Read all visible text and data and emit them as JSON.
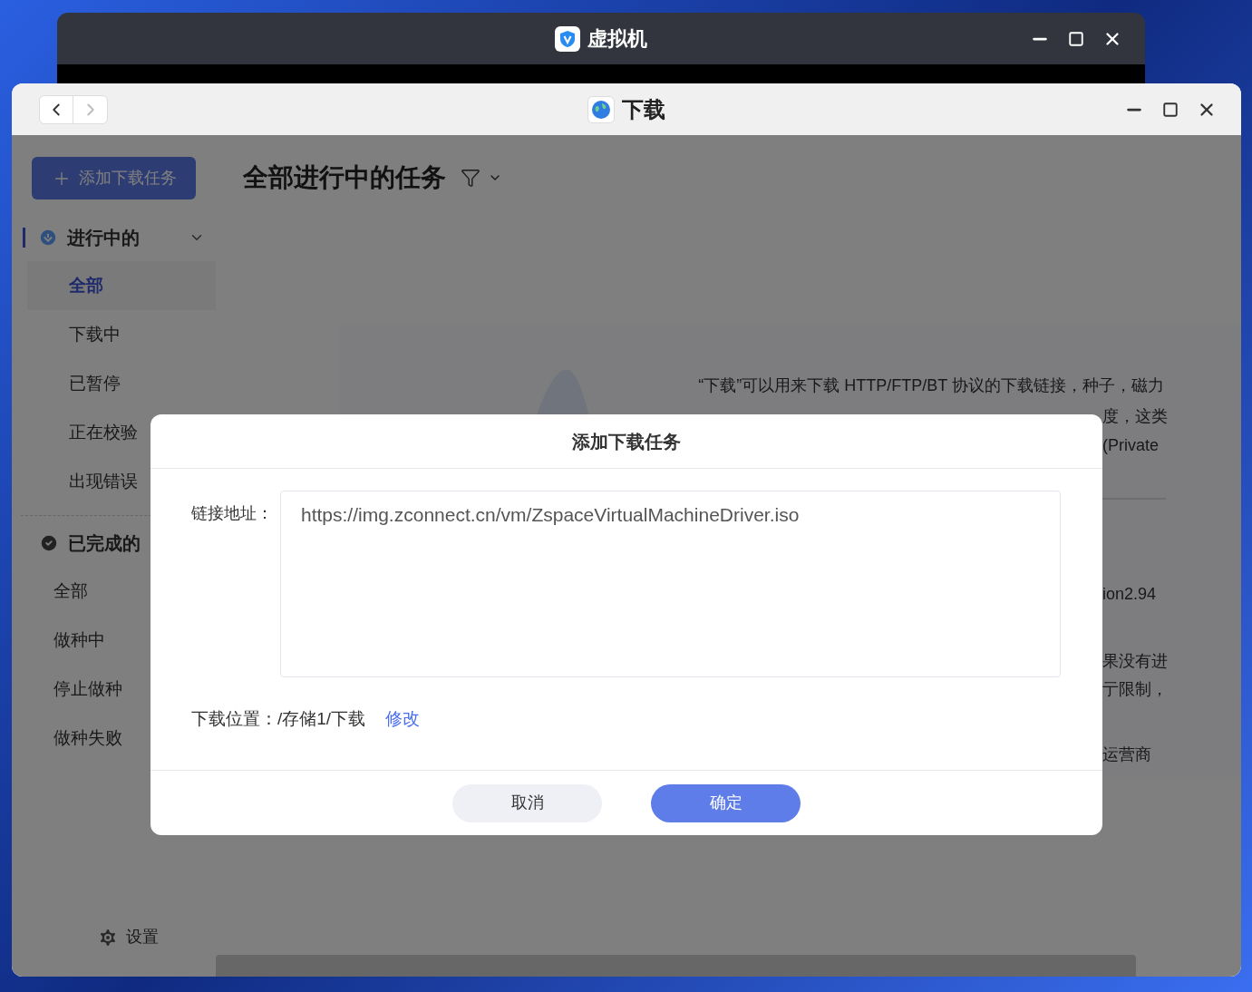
{
  "back_window": {
    "title": "虚拟机"
  },
  "window": {
    "title": "下载"
  },
  "sidebar": {
    "add_button": "添加下载任务",
    "sections": [
      {
        "title": "进行中的",
        "kind": "downloading",
        "items": [
          {
            "label": "全部",
            "selected": true
          },
          {
            "label": "下载中",
            "selected": false
          },
          {
            "label": "已暂停",
            "selected": false
          },
          {
            "label": "正在校验",
            "selected": false
          },
          {
            "label": "出现错误",
            "selected": false
          }
        ]
      },
      {
        "title": "已完成的",
        "kind": "done",
        "items": [
          {
            "label": "全部",
            "selected": false
          },
          {
            "label": "做种中",
            "selected": false
          },
          {
            "label": "停止做种",
            "selected": false
          },
          {
            "label": "做种失败",
            "selected": false
          }
        ]
      }
    ],
    "settings": "设置"
  },
  "main": {
    "title": "全部进行中的任务",
    "intro_fragments": [
      "“下载”可以用来下载 HTTP/FTP/BT 协议的下载链接，种子，磁力",
      "度，这类",
      "(Private",
      "ion2.94",
      "果没有进",
      "亍限制，",
      "运营商"
    ]
  },
  "dialog": {
    "title": "添加下载任务",
    "link_label": "链接地址：",
    "link_value": "https://img.zconnect.cn/vm/ZspaceVirtualMachineDriver.iso",
    "location_label": "下载位置：/存储1/下载",
    "change_link": "修改",
    "buttons": [
      {
        "label": "取消",
        "kind": "secondary"
      },
      {
        "label": "确定",
        "kind": "primary"
      }
    ]
  }
}
